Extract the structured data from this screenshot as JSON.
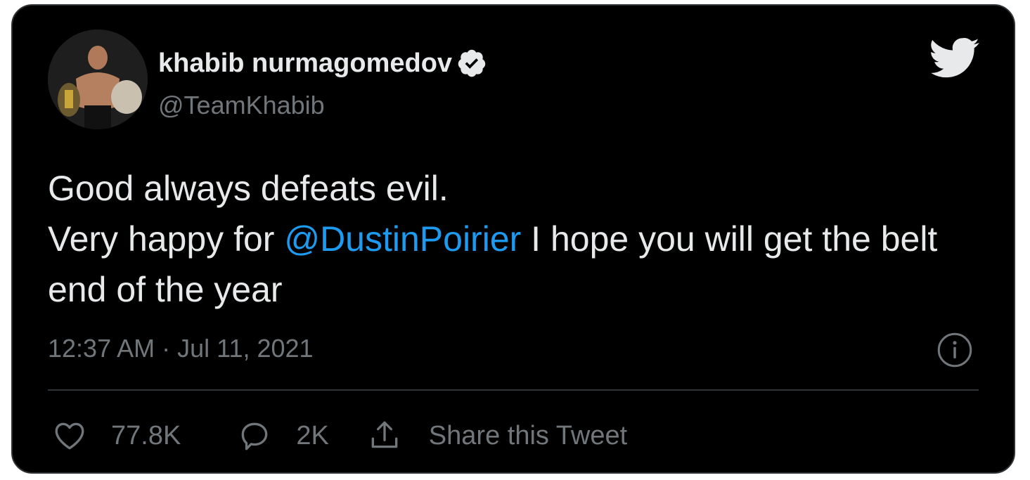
{
  "user": {
    "display_name": "khabib nurmagomedov",
    "handle": "@TeamKhabib",
    "verified": true,
    "avatar_icon": "profile-photo"
  },
  "tweet": {
    "line1": "Good always defeats evil.",
    "line2_before": "Very happy for ",
    "mention": "@DustinPoirier",
    "line2_after": " I hope you will get the belt end of the year",
    "timestamp": "12:37 AM · Jul 11, 2021"
  },
  "actions": {
    "like_count": "77.8K",
    "reply_count": "2K",
    "share_label": "Share this Tweet"
  },
  "icons": {
    "brand": "twitter-bird-icon",
    "info": "info-icon",
    "like": "heart-icon",
    "reply": "reply-bubble-icon",
    "share": "share-upload-icon"
  },
  "colors": {
    "background": "#000000",
    "text": "#e7e9ea",
    "secondary": "#71767b",
    "link": "#1d9bf0",
    "border": "#2f3336"
  }
}
